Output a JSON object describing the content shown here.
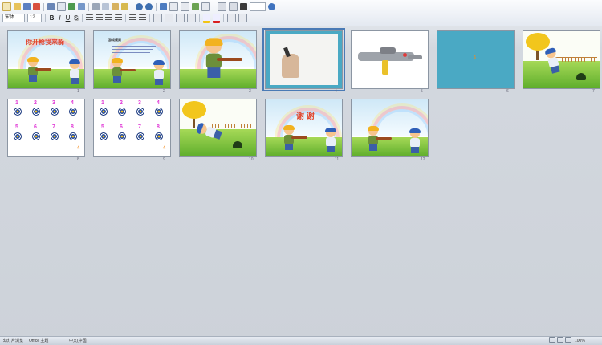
{
  "toolbar": {
    "font_name": "宋体",
    "font_size": "12",
    "bold": "B",
    "italic": "I",
    "underline": "U",
    "shadow": "S",
    "highlight_color": "#f2c514",
    "font_color": "#d91e1e"
  },
  "slides": [
    {
      "num": "1",
      "title": "你开枪我来躲"
    },
    {
      "num": "2",
      "title": "游戏规则"
    },
    {
      "num": "3"
    },
    {
      "num": "4"
    },
    {
      "num": "5"
    },
    {
      "num": "6",
      "center_mark": "6"
    },
    {
      "num": "7"
    },
    {
      "num": "8",
      "corner_mark": "4",
      "targets": [
        "1",
        "2",
        "3",
        "4",
        "5",
        "6",
        "7",
        "8"
      ]
    },
    {
      "num": "9",
      "corner_mark": "4",
      "targets": [
        "1",
        "2",
        "3",
        "4",
        "5",
        "6",
        "7",
        "8"
      ]
    },
    {
      "num": "10"
    },
    {
      "num": "11",
      "title": "谢 谢"
    },
    {
      "num": "12"
    }
  ],
  "status": {
    "slide_view": "幻灯片浏览",
    "theme": "Office 主题",
    "language": "中文(中国)",
    "zoom": "100%"
  },
  "colors": {
    "selected_slide_bg": "#4aa9c4",
    "accent": "#4a7ab5"
  }
}
